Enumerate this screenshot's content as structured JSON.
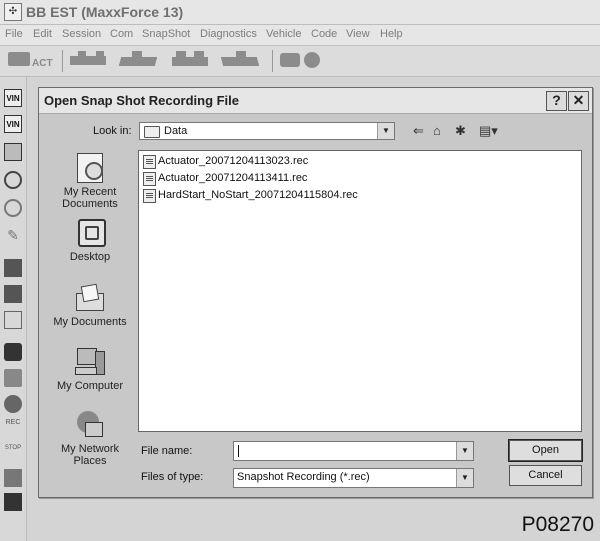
{
  "app": {
    "title": "BB EST (MaxxForce 13)"
  },
  "menu": [
    "File",
    "Edit",
    "Session",
    "Com",
    "SnapShot",
    "Diagnostics",
    "Vehicle",
    "Code",
    "View",
    "Help"
  ],
  "toolbar": {
    "act_label": "ACT"
  },
  "left_toolbar": {
    "vin_label": "VIN",
    "rec_label": "REC",
    "stop_label": "STOP"
  },
  "dialog": {
    "title": "Open Snap Shot Recording File",
    "help_glyph": "?",
    "close_glyph": "✕",
    "look_in_label": "Look in:",
    "look_in_value": "Data",
    "places": [
      {
        "label": "My Recent Documents",
        "icon": "recent-documents-icon"
      },
      {
        "label": "Desktop",
        "icon": "desktop-icon"
      },
      {
        "label": "My Documents",
        "icon": "my-documents-icon"
      },
      {
        "label": "My Computer",
        "icon": "my-computer-icon"
      },
      {
        "label": "My Network Places",
        "icon": "network-places-icon"
      }
    ],
    "files": [
      "Actuator_20071204113023.rec",
      "Actuator_20071204113411.rec",
      "HardStart_NoStart_20071204115804.rec"
    ],
    "file_name_label": "File name:",
    "file_name_value": "",
    "files_of_type_label": "Files of type:",
    "files_of_type_value": "Snapshot Recording (*.rec)",
    "open_label": "Open",
    "cancel_label": "Cancel"
  },
  "figure_label": "P08270"
}
